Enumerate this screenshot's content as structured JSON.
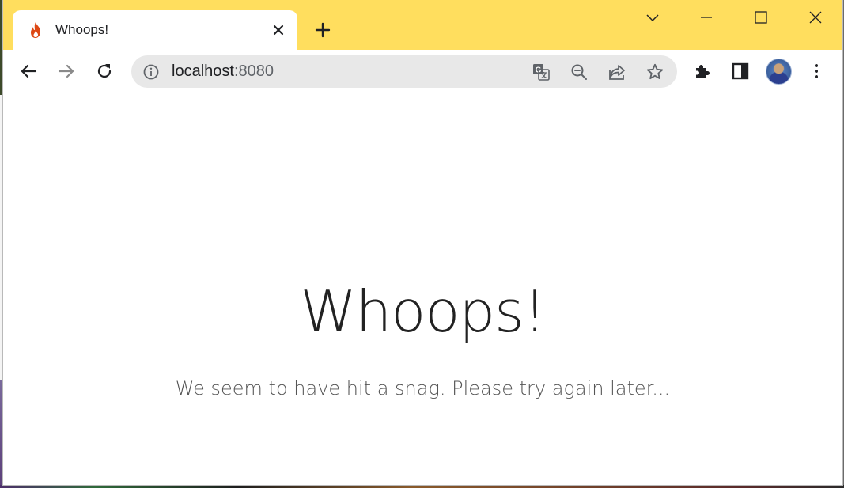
{
  "browser": {
    "tab": {
      "title": "Whoops!"
    },
    "address_bar": {
      "host": "localhost",
      "port": ":8080"
    },
    "icons": {
      "favicon": "flame-icon",
      "close_tab": "close-icon",
      "new_tab": "plus-icon",
      "tab_search": "chevron-down-icon",
      "minimize": "minimize-icon",
      "maximize": "maximize-icon",
      "close_window": "close-icon",
      "back": "back-arrow-icon",
      "forward": "forward-arrow-icon",
      "reload": "reload-icon",
      "site_info": "info-icon",
      "translate": "translate-icon",
      "zoom": "zoom-out-icon",
      "share": "share-icon",
      "bookmark": "star-icon",
      "extensions": "puzzle-icon",
      "side_panel": "side-panel-icon",
      "profile": "avatar",
      "menu": "kebab-menu-icon"
    },
    "colors": {
      "frame": "#ffde5e",
      "favicon": "#dd4814"
    }
  },
  "page": {
    "heading": "Whoops!",
    "message": "We seem to have hit a snag. Please try again later..."
  }
}
